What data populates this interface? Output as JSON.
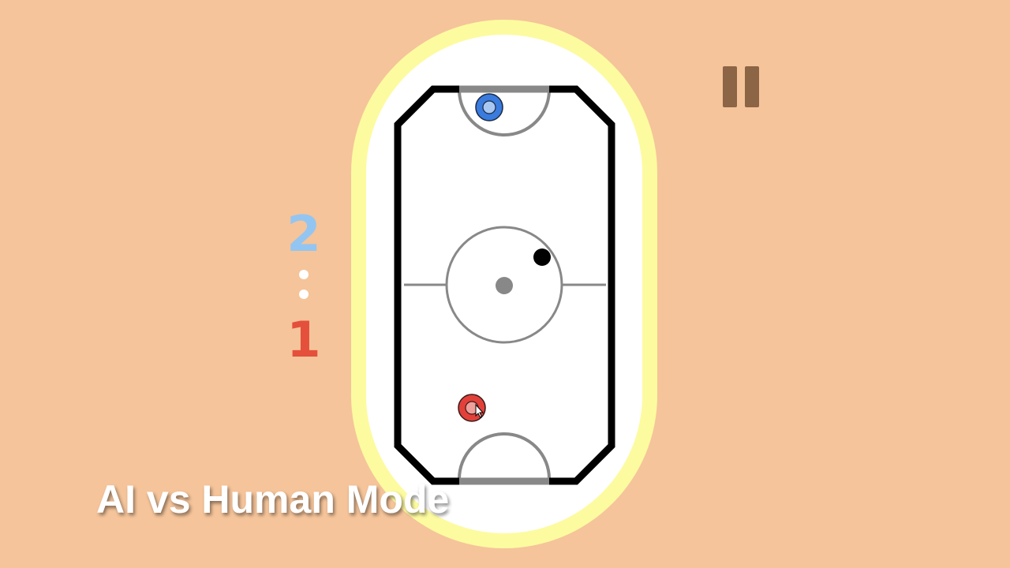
{
  "scoreboard": {
    "ai_score": "2",
    "human_score": "1",
    "ai_color": "#93C5F2",
    "human_color": "#E4503B",
    "separator_color": "#FFFFFF"
  },
  "mode_caption": "AI vs Human Mode",
  "pause_button": {
    "icon": "pause-icon",
    "color": "#8C6446"
  },
  "colors": {
    "background": "#F5C49A",
    "rink_glow": "#FDFBA0",
    "rink_surface": "#FFFFFF",
    "rink_border": "#000000",
    "rink_markings": "#888888",
    "ai_paddle": "#3A7BDE",
    "human_paddle": "#E2413A",
    "puck": "#000000"
  }
}
